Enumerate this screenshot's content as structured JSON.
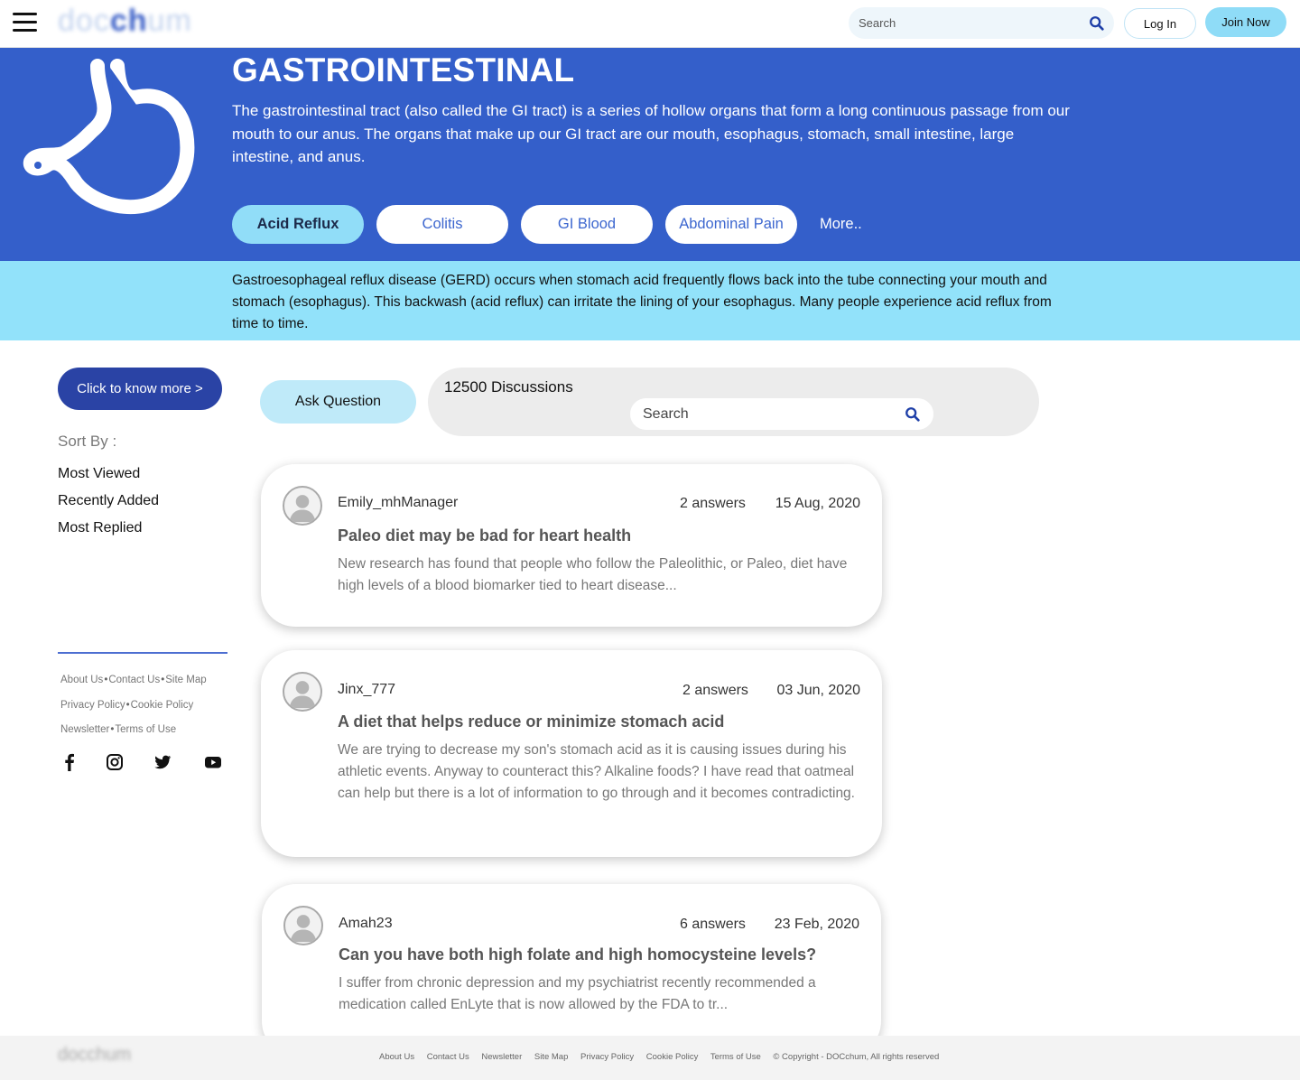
{
  "header": {
    "logo_text": "docchum",
    "search_placeholder": "Search",
    "login_label": "Log In",
    "join_label": "Join Now"
  },
  "hero": {
    "title": "GASTROINTESTINAL",
    "description": "The gastrointestinal tract (also called the GI tract) is a series of hollow organs that form a long continuous passage from our mouth to our anus. The organs that make up our GI tract are our mouth, esophagus, stomach, small intestine, large intestine, and anus.",
    "chips": [
      "Acid Reflux",
      "Colitis",
      "GI Blood",
      "Abdominal Pain"
    ],
    "active_chip": "Acid Reflux",
    "more_label": "More..",
    "icon": "stomach-icon",
    "colors": {
      "hero_bg": "#345fca",
      "band_bg": "#92e2fa",
      "accent": "#2a43a5"
    }
  },
  "definition": {
    "text": "Gastroesophageal reflux disease (GERD) occurs when stomach acid frequently flows back into the tube connecting your mouth and stomach (esophagus). This backwash (acid reflux) can irritate the lining of your esophagus. Many people experience acid reflux from time to time."
  },
  "sidebar": {
    "know_more_label": "Click to know more >",
    "sort_label": "Sort By :",
    "sort_options": [
      "Most Viewed",
      "Recently Added",
      "Most Replied"
    ],
    "links": {
      "about": "About Us",
      "contact": "Contact Us",
      "sitemap": "Site Map",
      "privacy": "Privacy Policy",
      "cookie": "Cookie Policy",
      "newsletter": "Newsletter",
      "terms": "Terms of Use"
    },
    "social_icons": [
      "facebook-icon",
      "instagram-icon",
      "twitter-icon",
      "youtube-icon"
    ]
  },
  "discussions": {
    "ask_label": "Ask Question",
    "count_label": "12500 Discussions",
    "search_placeholder": "Search",
    "posts": [
      {
        "user": "Emily_mhManager",
        "answers": "2 answers",
        "date": "15 Aug, 2020",
        "title": "Paleo diet may be bad for heart health",
        "body": "New research has found that people who follow the Paleolithic, or Paleo, diet have high levels of a blood biomarker tied to heart disease..."
      },
      {
        "user": "Jinx_777",
        "answers": "2 answers",
        "date": "03 Jun, 2020",
        "title": "A diet that helps reduce or minimize stomach acid",
        "body": "We are trying to decrease my son's stomach acid as it is causing issues during his athletic events. Anyway to counteract this? Alkaline foods? I have read that oatmeal can help but there is a lot of information to go through and it becomes contradicting."
      },
      {
        "user": "Amah23",
        "answers": "6 answers",
        "date": "23 Feb, 2020",
        "title": "Can you have both high folate and high homocysteine levels?",
        "body": "I suffer from chronic depression and my psychiatrist recently recommended a medication called EnLyte that is now allowed by the FDA to tr..."
      }
    ]
  },
  "footer": {
    "logo_text": "docchum",
    "links": [
      "About Us",
      "Contact Us",
      "Newsletter",
      "Site Map",
      "Privacy Policy",
      "Cookie Policy",
      "Terms of Use"
    ],
    "copyright": "© Copyright - DOCchum, All rights reserved"
  }
}
